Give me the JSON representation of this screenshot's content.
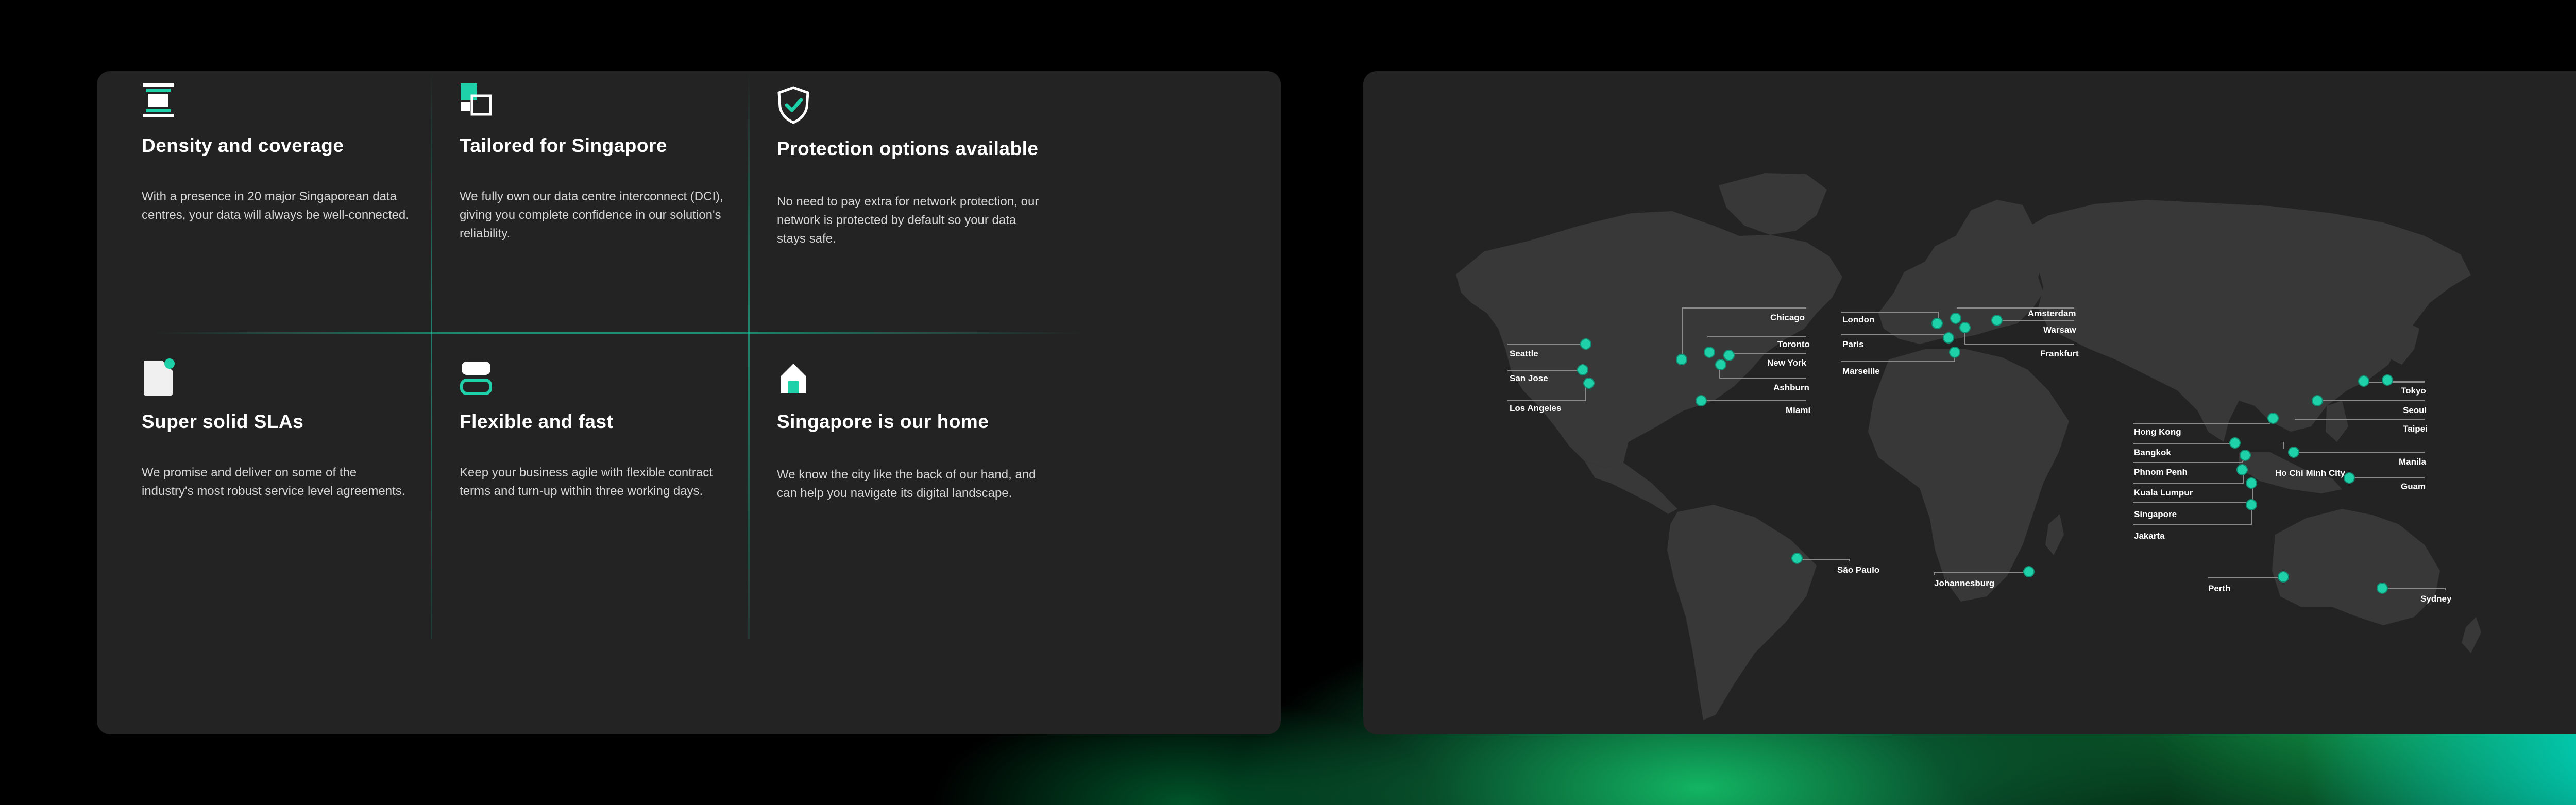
{
  "features": [
    {
      "id": "density",
      "title": "Density and coverage",
      "text": "With a presence in 20 major Singaporean data centres, your data will always be well-connected.",
      "icon": "server-stack-icon"
    },
    {
      "id": "tailored",
      "title": "Tailored for Singapore",
      "text": "We fully own our data centre interconnect (DCI), giving you complete confidence in our solution's reliability.",
      "icon": "overlapping-squares-icon"
    },
    {
      "id": "protection",
      "title": "Protection options available",
      "text": "No need to pay extra for network protection, our network is protected by default so your data stays safe.",
      "icon": "shield-check-icon"
    },
    {
      "id": "slas",
      "title": "Super solid SLAs",
      "text": "We promise and deliver on some of the industry's most robust service level agreements.",
      "icon": "document-badge-icon"
    },
    {
      "id": "flexible",
      "title": "Flexible and fast",
      "text": "Keep your business agile with flexible contract terms and turn-up within three working days.",
      "icon": "stacked-toggle-icon"
    },
    {
      "id": "home",
      "title": "Singapore is our home",
      "text": "We know the city like the back of our hand, and can help you navigate its digital landscape.",
      "icon": "home-icon"
    }
  ],
  "map": {
    "cities": [
      "Seattle",
      "San Jose",
      "Los Angeles",
      "Chicago",
      "Toronto",
      "New York",
      "Ashburn",
      "Miami",
      "London",
      "Paris",
      "Marseille",
      "Amsterdam",
      "Warsaw",
      "Frankfurt",
      "São Paulo",
      "Johannesburg",
      "Hong Kong",
      "Bangkok",
      "Phnom Penh",
      "Kuala Lumpur",
      "Singapore",
      "Jakarta",
      "Ho Chi Minh City",
      "Manila",
      "Guam",
      "Tokyo",
      "Seoul",
      "Taipei",
      "Perth",
      "Sydney"
    ]
  },
  "colors": {
    "accent": "#1fd1a8",
    "card": "#232323",
    "land": "#383838",
    "background": "#000000"
  }
}
